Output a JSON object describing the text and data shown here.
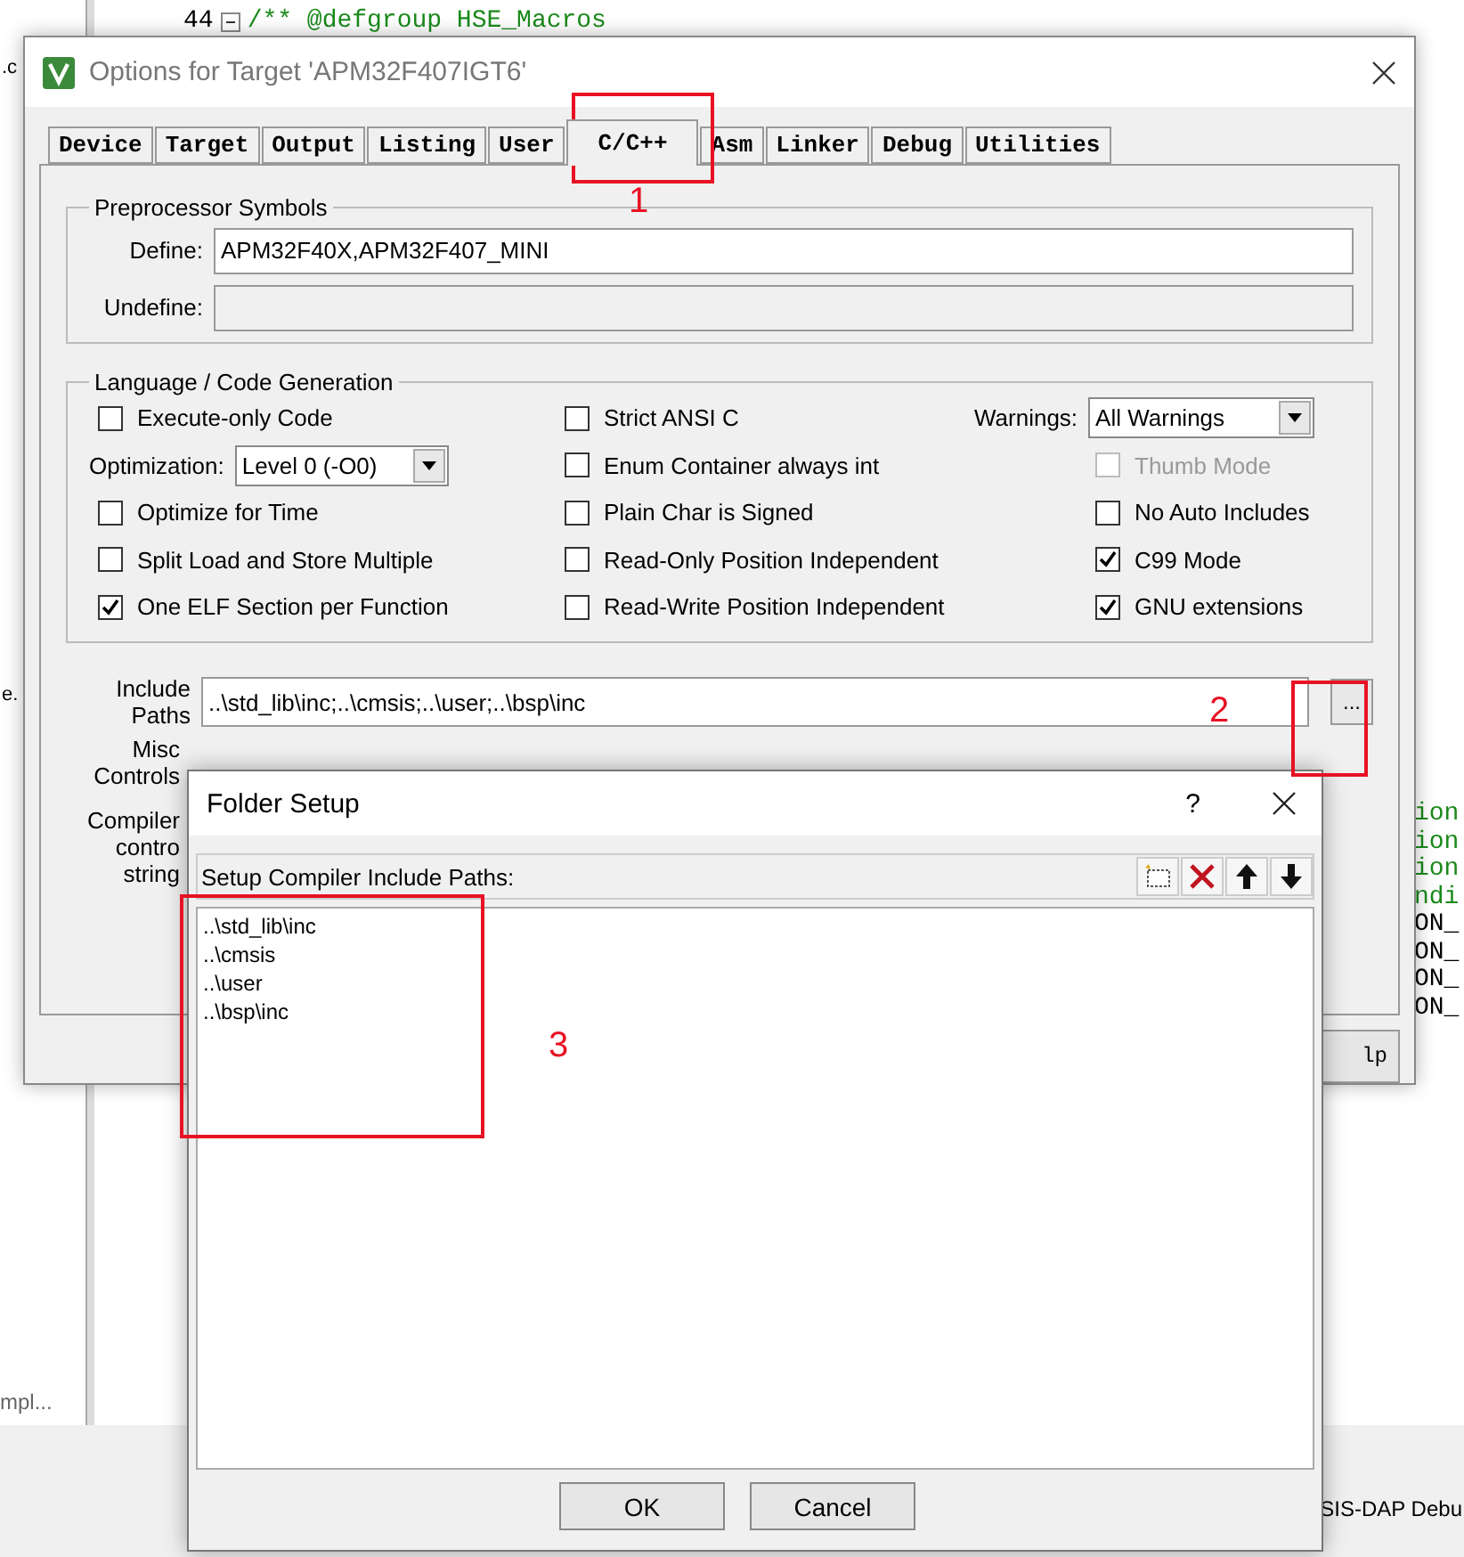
{
  "editor": {
    "line_number": "44",
    "code": "/** @defgroup HSE_Macros",
    "fragments": [
      {
        "text": "ion",
        "kind": "comment"
      },
      {
        "text": "ion",
        "kind": "comment"
      },
      {
        "text": "ion",
        "kind": "comment"
      },
      {
        "text": "ndi",
        "kind": "comment"
      },
      {
        "text": "ON_",
        "kind": "code"
      },
      {
        "text": "ON_",
        "kind": "code"
      },
      {
        "text": "ON_",
        "kind": "code"
      },
      {
        "text": "ON_",
        "kind": "code"
      }
    ],
    "side_texts": [
      ".c",
      "e."
    ],
    "panel_tab": "mpl...",
    "status": "SIS-DAP Debu"
  },
  "options_dialog": {
    "title": "Options for Target 'APM32F407IGT6'",
    "tabs": [
      {
        "label": "Device",
        "selected": false
      },
      {
        "label": "Target",
        "selected": false
      },
      {
        "label": "Output",
        "selected": false
      },
      {
        "label": "Listing",
        "selected": false
      },
      {
        "label": "User",
        "selected": false
      },
      {
        "label": "C/C++",
        "selected": true
      },
      {
        "label": "Asm",
        "selected": false
      },
      {
        "label": "Linker",
        "selected": false
      },
      {
        "label": "Debug",
        "selected": false
      },
      {
        "label": "Utilities",
        "selected": false
      }
    ],
    "preprocessor": {
      "title": "Preprocessor Symbols",
      "define_label": "Define:",
      "define": "APM32F40X,APM32F407_MINI",
      "undefine_label": "Undefine:"
    },
    "language": {
      "title": "Language / Code Generation",
      "columns": [
        [
          {
            "kind": "checkbox",
            "label": "Execute-only Code",
            "checked": false,
            "disabled": false
          },
          {
            "kind": "dropdown",
            "label": "Optimization:",
            "value": "Level 0 (-O0)"
          },
          {
            "kind": "checkbox",
            "label": "Optimize for Time",
            "checked": false,
            "disabled": false
          },
          {
            "kind": "checkbox",
            "label": "Split Load and Store Multiple",
            "checked": false,
            "disabled": false
          },
          {
            "kind": "checkbox",
            "label": "One ELF Section per Function",
            "checked": true,
            "disabled": false
          }
        ],
        [
          {
            "kind": "checkbox",
            "label": "Strict ANSI C",
            "checked": false,
            "disabled": false
          },
          {
            "kind": "checkbox",
            "label": "Enum Container always int",
            "checked": false,
            "disabled": false
          },
          {
            "kind": "checkbox",
            "label": "Plain Char is Signed",
            "checked": false,
            "disabled": false
          },
          {
            "kind": "checkbox",
            "label": "Read-Only Position Independent",
            "checked": false,
            "disabled": false
          },
          {
            "kind": "checkbox",
            "label": "Read-Write Position Independent",
            "checked": false,
            "disabled": false
          }
        ],
        [
          {
            "kind": "dropdown",
            "label": "Warnings:",
            "value": "All Warnings"
          },
          {
            "kind": "checkbox",
            "label": "Thumb Mode",
            "checked": false,
            "disabled": true
          },
          {
            "kind": "checkbox",
            "label": "No Auto Includes",
            "checked": false,
            "disabled": false
          },
          {
            "kind": "checkbox",
            "label": "C99 Mode",
            "checked": true,
            "disabled": false
          },
          {
            "kind": "checkbox",
            "label": "GNU extensions",
            "checked": true,
            "disabled": false
          }
        ]
      ]
    },
    "include_paths": {
      "label": "Include Paths",
      "value": "..\\std_lib\\inc;..\\cmsis;..\\user;..\\bsp\\inc",
      "button": "..."
    },
    "misc_label": [
      "Misc",
      "Controls"
    ],
    "compiler_label": [
      "Compiler",
      "contro",
      "string"
    ],
    "button": "lp"
  },
  "folder_dialog": {
    "title": "Folder Setup",
    "help": "?",
    "header": "Setup Compiler Include Paths:",
    "paths": [
      "..\\std_lib\\inc",
      "..\\cmsis",
      "..\\user",
      "..\\bsp\\inc"
    ],
    "buttons": [
      "OK",
      "Cancel"
    ]
  },
  "annotations": [
    {
      "label": "1"
    },
    {
      "label": "2"
    },
    {
      "label": "3"
    }
  ]
}
